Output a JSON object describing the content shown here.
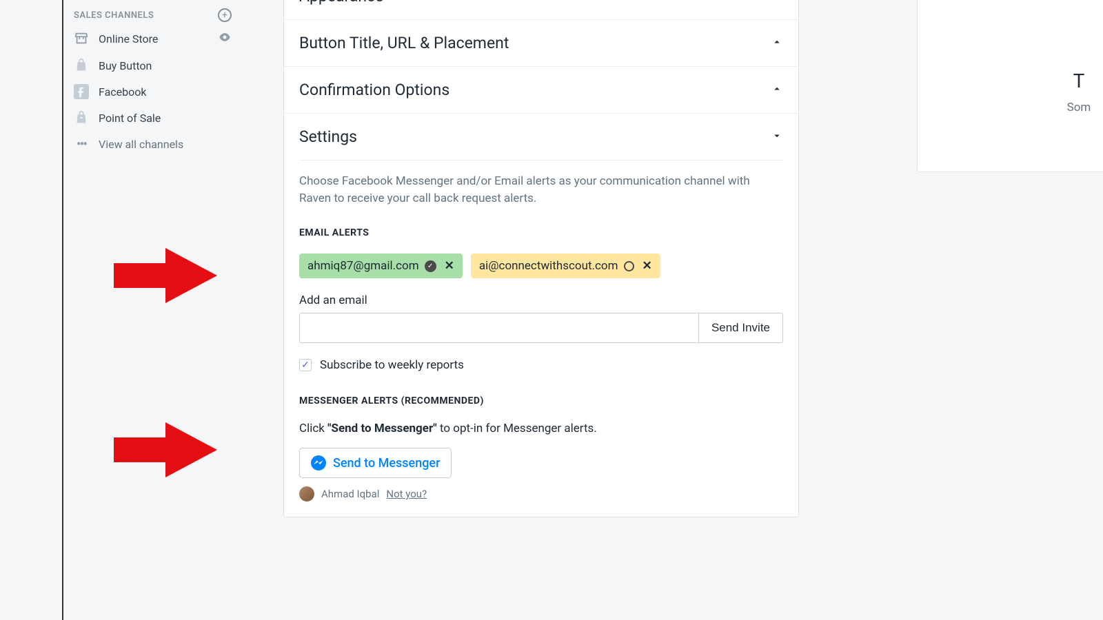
{
  "sidebar": {
    "section_title": "SALES CHANNELS",
    "items": [
      {
        "label": "Online Store",
        "icon": "store",
        "has_eye": true
      },
      {
        "label": "Buy Button",
        "icon": "bag"
      },
      {
        "label": "Facebook",
        "icon": "facebook"
      },
      {
        "label": "Point of Sale",
        "icon": "bag2"
      }
    ],
    "view_all": "View all channels"
  },
  "accordion": {
    "appearance": "Appearance",
    "button_title": "Button Title, URL & Placement",
    "confirmation": "Confirmation Options",
    "settings": "Settings"
  },
  "settings": {
    "description": "Choose Facebook Messenger and/or Email alerts as your communication channel with Raven to receive your call back request alerts.",
    "email_alerts_heading": "EMAIL ALERTS",
    "pills": [
      {
        "email": "ahmiq87@gmail.com",
        "verified": true,
        "color": "green"
      },
      {
        "email": "ai@connectwithscout.com",
        "verified": false,
        "color": "yellow"
      }
    ],
    "add_email_label": "Add an email",
    "send_invite": "Send Invite",
    "subscribe_label": "Subscribe to weekly reports",
    "subscribe_checked": true,
    "messenger_heading": "MESSENGER ALERTS (RECOMMENDED)",
    "messenger_prefix": "Click ",
    "messenger_bold": "\"Send to Messenger\"",
    "messenger_suffix": " to opt-in for Messenger alerts.",
    "messenger_button": "Send to Messenger",
    "user_name": "Ahmad Iqbal",
    "not_you": "Not you?"
  },
  "side_card": {
    "title_fragment": "T",
    "sub_fragment": "Som"
  }
}
